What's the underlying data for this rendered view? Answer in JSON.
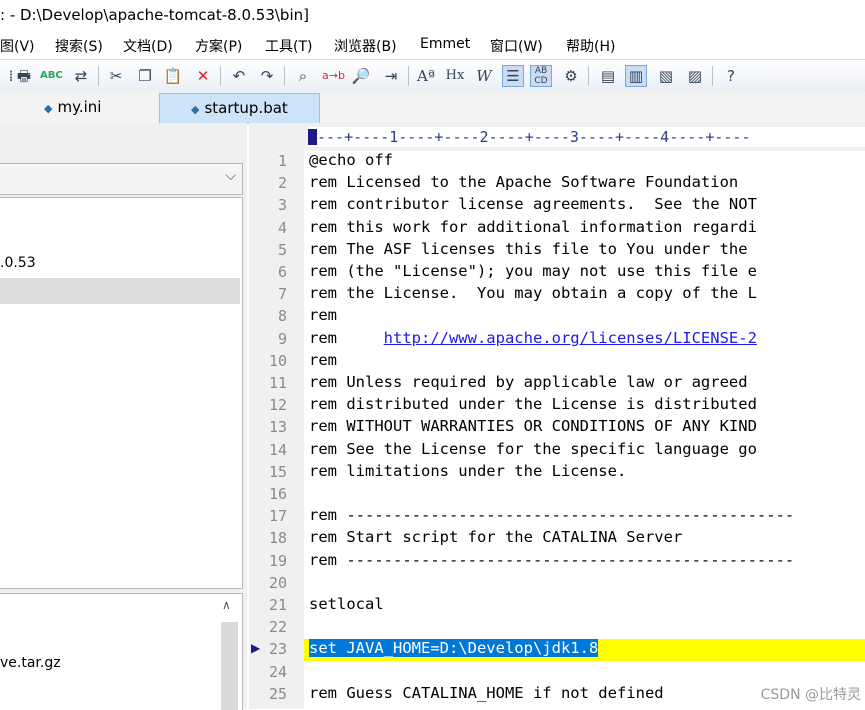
{
  "window": {
    "title": ": - D:\\Develop\\apache-tomcat-8.0.53\\bin]"
  },
  "menu": [
    {
      "label": "图(V)"
    },
    {
      "label": "搜索(S)"
    },
    {
      "label": "文档(D)"
    },
    {
      "label": "方案(P)"
    },
    {
      "label": "工具(T)"
    },
    {
      "label": "浏览器(B)"
    },
    {
      "label": "Emmet"
    },
    {
      "label": "窗口(W)"
    },
    {
      "label": "帮助(H)"
    }
  ],
  "toolbar": {
    "icons": [
      "print-icon",
      "spellcheck-icon",
      "convert-icon",
      "cut-icon",
      "copy-icon",
      "paste-icon",
      "delete-icon",
      "undo-icon",
      "redo-icon",
      "find-icon",
      "replace-icon",
      "find-in-files-icon",
      "goto-line-icon",
      "font-size-icon",
      "hex-icon",
      "word-wrap-icon",
      "indent-icon",
      "abc-icon",
      "settings-icon",
      "view-1-icon",
      "view-2-icon",
      "view-3-icon",
      "view-4-icon",
      "help-icon"
    ]
  },
  "tabs": [
    {
      "label": "my.ini",
      "active": false
    },
    {
      "label": "startup.bat",
      "active": true
    }
  ],
  "left_panel": {
    "tree_items": [
      ".0.53"
    ],
    "file_items": [
      "ve.tar.gz"
    ]
  },
  "editor": {
    "ruler": "---+----1----+----2----+----3----+----4----+----",
    "lines": [
      {
        "n": "1",
        "text": "@echo off"
      },
      {
        "n": "2",
        "text": "rem Licensed to the Apache Software Foundation"
      },
      {
        "n": "3",
        "text": "rem contributor license agreements.  See the NOT"
      },
      {
        "n": "4",
        "text": "rem this work for additional information regardi"
      },
      {
        "n": "5",
        "text": "rem The ASF licenses this file to You under the"
      },
      {
        "n": "6",
        "text": "rem (the \"License\"); you may not use this file e"
      },
      {
        "n": "7",
        "text": "rem the License.  You may obtain a copy of the L"
      },
      {
        "n": "8",
        "text": "rem"
      },
      {
        "n": "9",
        "text": "rem     ",
        "link": "http://www.apache.org/licenses/LICENSE-2"
      },
      {
        "n": "10",
        "text": "rem"
      },
      {
        "n": "11",
        "text": "rem Unless required by applicable law or agreed"
      },
      {
        "n": "12",
        "text": "rem distributed under the License is distributed"
      },
      {
        "n": "13",
        "text": "rem WITHOUT WARRANTIES OR CONDITIONS OF ANY KIND"
      },
      {
        "n": "14",
        "text": "rem See the License for the specific language go"
      },
      {
        "n": "15",
        "text": "rem limitations under the License."
      },
      {
        "n": "16",
        "text": ""
      },
      {
        "n": "17",
        "text": "rem ------------------------------------------------"
      },
      {
        "n": "18",
        "text": "rem Start script for the CATALINA Server"
      },
      {
        "n": "19",
        "text": "rem ------------------------------------------------"
      },
      {
        "n": "20",
        "text": ""
      },
      {
        "n": "21",
        "text": "setlocal"
      },
      {
        "n": "22",
        "text": ""
      },
      {
        "n": "23",
        "text": "set JAVA_HOME=D:\\Develop\\jdk1.8",
        "selected": true
      },
      {
        "n": "24",
        "text": ""
      },
      {
        "n": "25",
        "text": "rem Guess CATALINA_HOME if not defined"
      }
    ]
  },
  "watermark": "CSDN @比特灵",
  "colors": {
    "highlight": "#ffff00",
    "selection": "#0078d7",
    "link": "#1a1aee",
    "active_tab": "#cde3f7"
  }
}
